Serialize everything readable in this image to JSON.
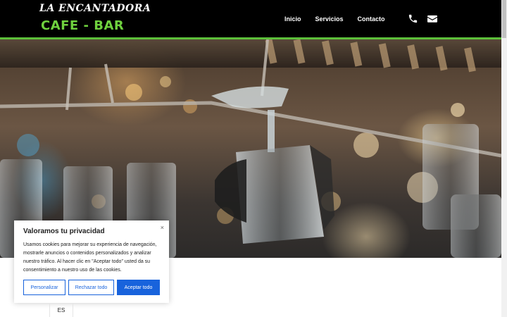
{
  "header": {
    "logo_top": "LA ENCANTADORA",
    "logo_bottom": "CAFE - BAR",
    "nav": [
      "Inicio",
      "Servicios",
      "Contacto"
    ],
    "icons": [
      "phone-icon",
      "envelope-icon"
    ],
    "accent": "#5cbf3a"
  },
  "hero": {
    "image": "hanging-glasses-photo"
  },
  "cookie": {
    "title": "Valoramos tu privacidad",
    "close": "×",
    "text": "Usamos cookies para mejorar su experiencia de navegación, mostrarle anuncios o contenidos personalizados y analizar nuestro tráfico. Al hacer clic en \"Aceptar todo\" usted da su consentimiento a nuestro uso de las cookies.",
    "buttons": {
      "customize": "Personalizar",
      "reject": "Rechazar todo",
      "accept": "Aceptar todo"
    },
    "accent": "#1863dc"
  },
  "language": {
    "current": "ES"
  }
}
